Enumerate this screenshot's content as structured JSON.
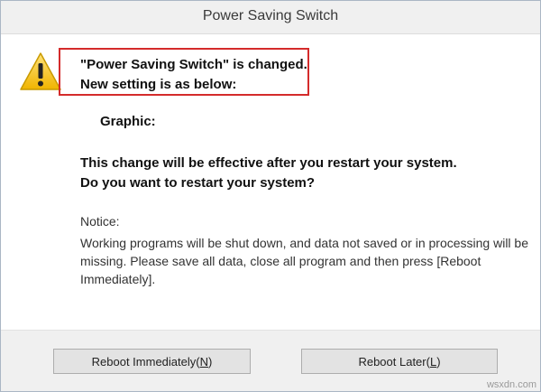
{
  "window": {
    "title": "Power Saving Switch"
  },
  "message": {
    "line1": "\"Power Saving Switch\" is changed.",
    "line2": "New setting is as below:",
    "setting_label": "Graphic:",
    "effect_line1": "This change will be effective after you restart your system.",
    "effect_line2": "Do you want to restart your system?"
  },
  "notice": {
    "title": "Notice:",
    "body": "Working programs will be shut down, and data not saved or in processing will be missing. Please save all data, close all program and then press [Reboot Immediately]."
  },
  "buttons": {
    "reboot_now_text": "Reboot Immediately",
    "reboot_now_key": "N",
    "reboot_later_text": "Reboot Later",
    "reboot_later_key": "L"
  },
  "watermark": "wsxdn.com",
  "colors": {
    "highlight": "#d42b2b",
    "warning_fill": "#f2c21a"
  },
  "icons": {
    "warning": "warning-icon"
  }
}
